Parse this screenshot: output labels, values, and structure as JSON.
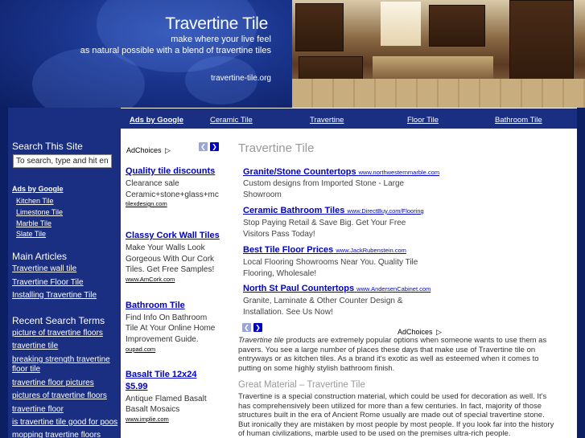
{
  "header": {
    "title": "Travertine Tile",
    "tagline1": "make where your live feel",
    "tagline2": "as natural possible with a blend of travertine tiles",
    "url": "travertine-tile.org"
  },
  "nav": {
    "ads_label": "Ads by Google",
    "links": [
      "Ceramic Tile",
      "Travertine",
      "Floor Tile",
      "Bathroom Tile"
    ]
  },
  "sidebar": {
    "search_heading": "Search This Site",
    "search_value": "To search, type and hit ent",
    "ads_label": "Ads by Google",
    "ad_links": [
      "Kitchen Tile",
      "Limestone Tile",
      "Marble Tile",
      "Slate Tile"
    ],
    "main_heading": "Main Articles",
    "main_links": [
      "Travertine wall tile",
      "Travertine Floor Tile",
      "Installing Travertine Tile"
    ],
    "recent_heading": "Recent Search Terms",
    "recent_links": [
      "picture of travertine floors",
      "travertine tile",
      "breaking strength travertine",
      "floor tile",
      "travertine floor pictures",
      "pictures of travertine floors",
      "travertine floor",
      "is travertine tile good for poos",
      "mopping travertine floors"
    ]
  },
  "left_ads": {
    "adchoices": "AdChoices",
    "items": [
      {
        "title": "Quality tile discounts",
        "text1": "Clearance sale",
        "text2": "Ceramic+stone+glass+mc",
        "url": "tilexdesign.com"
      },
      {
        "title": "Classy Cork Wall Tiles",
        "text1": "Make Your Walls Look",
        "text2": "Gorgeous With Our Cork",
        "text3": "Tiles. Get Free Samples!",
        "url": "www.AmCork.com"
      },
      {
        "title": "Bathroom Tile",
        "text1": "Find Info On Bathroom",
        "text2": "Tile At Your Online Home",
        "text3": "Improvement Guide.",
        "url": "oupad.com"
      },
      {
        "title": "Basalt Tile 12x24",
        "title2": "$5.99",
        "text1": "Antique Flamed Basalt",
        "text2": "Basalt Mosaics",
        "url": "www.implie.com"
      }
    ]
  },
  "main": {
    "title": "Travertine Tile",
    "ads": [
      {
        "title": "Granite/Stone Countertops",
        "url": "www.northwesternmarble.com",
        "text1": "Custom designs from Imported Stone - Large",
        "text2": "Showroom"
      },
      {
        "title": "Ceramic Bathroom Tiles",
        "url": "www.DirectBuy.com/Flooring",
        "text1": "Stop Paying Retail & Save Big. Get Your Free",
        "text2": "Visitors Pass Today!"
      },
      {
        "title": "Best Tile Floor Prices",
        "url": "www.JackRubenstein.com",
        "text1": "Local Flooring Showrooms Near You. Quality Tile",
        "text2": "Flooring, Wholesale!"
      },
      {
        "title": "North St Paul Countertops",
        "url": "www.AndersenCabinet.com",
        "text1": "Granite, Laminate & Other Counter Design &",
        "text2": "Installation. See Us Now!"
      }
    ],
    "adchoices": "AdChoices",
    "para1_em": "Travertine tile",
    "para1_lines": [
      " products are extremely popular options when someone wants to use them as",
      "pavers. You see a large number of places these days that make use of Travertine tile on",
      "entryways or as kitchen tiles. As a brand it's exotic as well as esteemed when it comes to",
      "putting on some highly stylish bathroom finish."
    ],
    "section_heading": "Great Material – Travertine Tile",
    "para2_lines": [
      "Travertine is a special construction material, which could be used for decoration as well. It's",
      "has comprehensively been utilized for more than a few centuries. In fact, majority of those",
      "structures built in the era of Ancient Rome usually are made out of special travertine stone.",
      "But ironically they are mistaken by most people by most people. If you look far into the history",
      "of human civilizations, marble used to be used on the premises ultra-rich people."
    ]
  },
  "colors": {
    "page_bg": "#0d1f63",
    "sidebar_bg": "#1b2f82",
    "link_blue": "#0000cc",
    "heading_grey": "#999999"
  }
}
